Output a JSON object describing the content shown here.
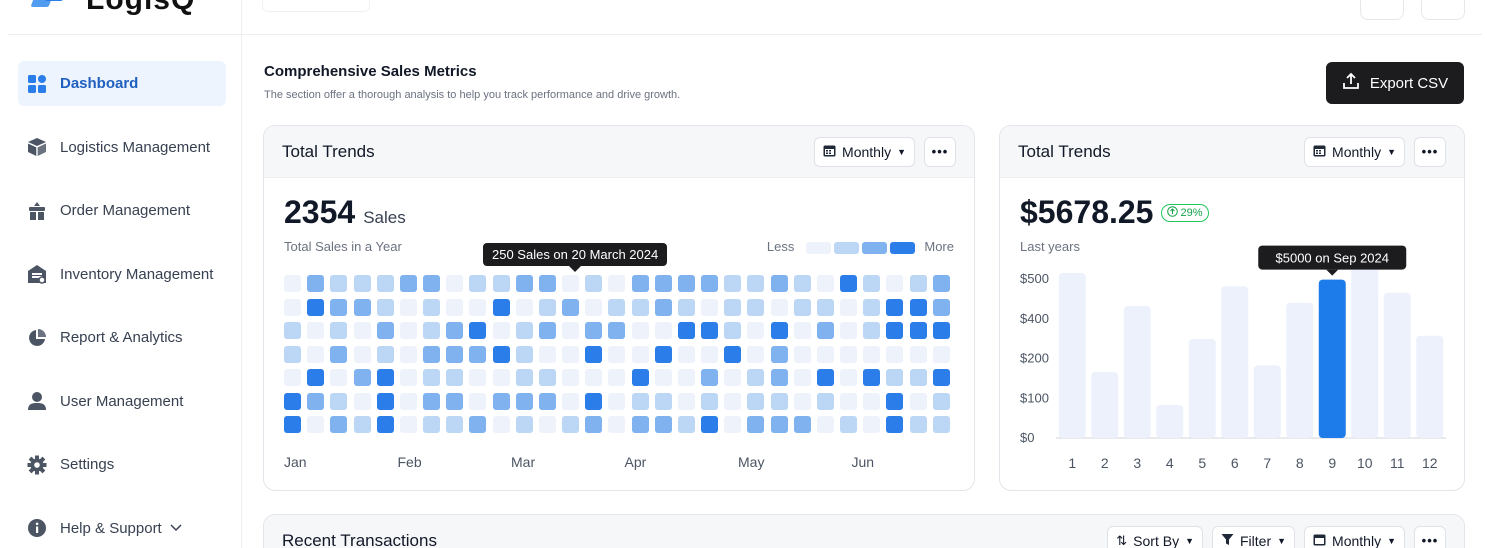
{
  "app": {
    "logo_text": "LogisQ"
  },
  "sidebar": {
    "items": [
      {
        "label": "Dashboard",
        "icon": "grid-icon",
        "active": true
      },
      {
        "label": "Logistics Management",
        "icon": "box-icon"
      },
      {
        "label": "Order Management",
        "icon": "cart-icon"
      },
      {
        "label": "Inventory Management",
        "icon": "warehouse-icon"
      },
      {
        "label": "Report & Analytics",
        "icon": "pie-chart-icon"
      },
      {
        "label": "User Management",
        "icon": "user-icon"
      },
      {
        "label": "Settings",
        "icon": "gear-icon"
      },
      {
        "label": "Help & Support",
        "icon": "info-icon",
        "expandable": true
      }
    ]
  },
  "header": {
    "title": "Comprehensive Sales Metrics",
    "subtitle": "The section offer a thorough analysis to help you track performance and drive growth.",
    "export_label": "Export CSV"
  },
  "heatmap_card": {
    "title": "Total Trends",
    "period": "Monthly",
    "total": "2354",
    "unit": "Sales",
    "caption": "Total Sales in a Year",
    "legend_less": "Less",
    "legend_more": "More",
    "tooltip": "250 Sales on 20 March 2024",
    "months": [
      "Jan",
      "Feb",
      "Mar",
      "Apr",
      "May",
      "Jun"
    ],
    "colors": [
      "#edf2fb",
      "#bcd6f5",
      "#7fb2ef",
      "#2b7de9"
    ],
    "grid": [
      [
        0,
        2,
        1,
        1,
        1,
        2,
        2,
        0,
        1,
        1,
        2,
        2,
        0,
        1,
        0,
        2,
        2,
        2,
        2,
        1,
        1,
        2,
        1,
        0,
        3,
        1,
        0,
        1,
        2
      ],
      [
        0,
        3,
        2,
        2,
        1,
        0,
        1,
        0,
        0,
        3,
        0,
        1,
        2,
        0,
        1,
        1,
        2,
        1,
        0,
        1,
        1,
        0,
        1,
        1,
        0,
        1,
        3,
        3,
        2
      ],
      [
        1,
        0,
        1,
        0,
        2,
        0,
        1,
        2,
        3,
        0,
        1,
        2,
        0,
        2,
        2,
        0,
        0,
        3,
        3,
        1,
        0,
        3,
        0,
        2,
        0,
        1,
        3,
        3,
        3
      ],
      [
        1,
        0,
        2,
        0,
        1,
        0,
        2,
        2,
        2,
        3,
        1,
        0,
        0,
        3,
        0,
        0,
        3,
        0,
        0,
        3,
        0,
        2,
        0,
        0,
        0,
        0,
        0,
        0,
        0
      ],
      [
        0,
        3,
        0,
        2,
        3,
        0,
        1,
        1,
        0,
        0,
        1,
        1,
        0,
        0,
        0,
        3,
        0,
        0,
        2,
        0,
        1,
        2,
        0,
        3,
        0,
        3,
        1,
        1,
        3
      ],
      [
        3,
        2,
        1,
        0,
        3,
        0,
        2,
        2,
        0,
        2,
        2,
        2,
        0,
        3,
        0,
        1,
        1,
        0,
        1,
        0,
        1,
        1,
        0,
        1,
        0,
        0,
        3,
        0,
        1
      ],
      [
        3,
        0,
        2,
        1,
        3,
        0,
        1,
        1,
        2,
        0,
        1,
        0,
        1,
        2,
        0,
        2,
        2,
        1,
        3,
        0,
        2,
        2,
        2,
        0,
        1,
        0,
        3,
        1,
        1
      ]
    ]
  },
  "bar_card": {
    "title": "Total Trends",
    "period": "Monthly",
    "amount": "$5678.25",
    "growth": "29%",
    "caption": "Last years",
    "tooltip": "$5000 on Sep 2024",
    "highlight_color": "#1e7bea",
    "base_color": "#ecf1fc"
  },
  "chart_data": {
    "type": "bar",
    "categories": [
      "1",
      "2",
      "3",
      "4",
      "5",
      "6",
      "7",
      "8",
      "9",
      "10",
      "11",
      "12"
    ],
    "values": [
      500,
      200,
      400,
      100,
      300,
      460,
      220,
      410,
      480,
      540,
      440,
      310
    ],
    "y_ticks": [
      "$0",
      "$100",
      "$200",
      "$400",
      "$500"
    ],
    "ylim": [
      0,
      500
    ],
    "highlight_index": 8
  },
  "transactions": {
    "title": "Recent Transactions",
    "sort_label": "Sort By",
    "filter_label": "Filter",
    "period": "Monthly"
  }
}
